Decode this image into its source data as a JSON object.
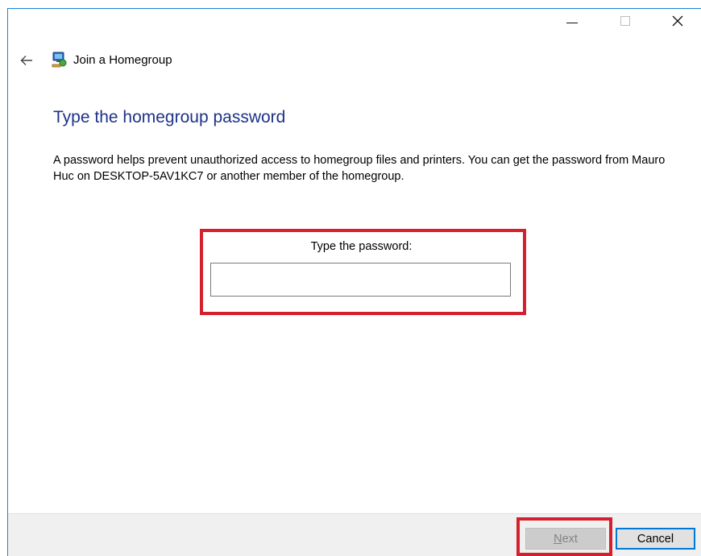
{
  "window": {
    "title": "Join a Homegroup",
    "caption": {
      "minimize": "—",
      "maximize": "□",
      "close": "✕"
    }
  },
  "nav": {
    "back_icon": "back-arrow-icon",
    "app_icon": "homegroup-icon"
  },
  "content": {
    "heading": "Type the homegroup password",
    "description": "A password helps prevent unauthorized access to homegroup files and printers. You can get the password from Mauro Huc on DESKTOP-5AV1KC7 or another member of the homegroup.",
    "password_label": "Type the password:",
    "password_value": ""
  },
  "footer": {
    "next_label_access": "N",
    "next_label_rest": "ext",
    "cancel_label": "Cancel"
  },
  "colors": {
    "heading": "#1e3287",
    "highlight": "#d4202e",
    "accent": "#0078d7"
  }
}
